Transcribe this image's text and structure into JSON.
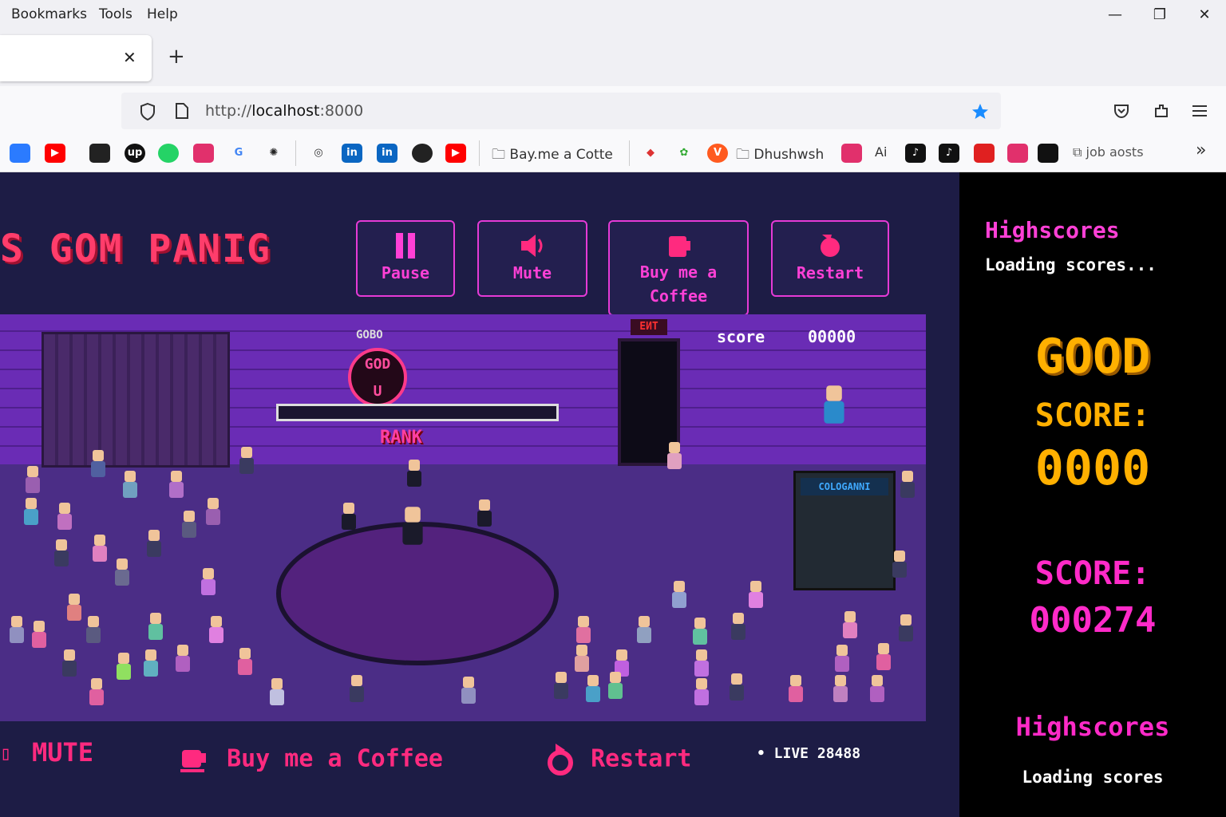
{
  "menu": {
    "bookmarks": "Bookmarks",
    "tools": "Tools",
    "help": "Help"
  },
  "window": {
    "minimize": "—",
    "maximize": "❐",
    "close": "✕"
  },
  "tab": {
    "close": "✕",
    "new": "+"
  },
  "address": {
    "scheme": "http://",
    "host": "localhost",
    "port": ":8000"
  },
  "bookmarks": {
    "folder1": "Bay.me a Cotte",
    "folder2": "Dhushwsh",
    "ai": "Ai",
    "folder3": "job aosts",
    "more": "»"
  },
  "game": {
    "title": "S GOM PANIG",
    "buttons": {
      "pause": "Pause",
      "mute": "Mute",
      "coffee_line1": "Buy me a",
      "coffee_line2": "Coffee",
      "restart": "Restart"
    },
    "scene": {
      "good_tag": "GOBO",
      "sign_top": "GOD",
      "sign_bottom": "U",
      "rank": "RANK",
      "exit": "EИT",
      "score_label": "score",
      "score_value": "00000",
      "bar_sign": "COLOGANNI"
    },
    "bottom": {
      "mute": "MUTE",
      "coffee": "Buy me a Coffee",
      "restart": "Restart",
      "live": "• LIVE 28488"
    }
  },
  "sidebar": {
    "title": "Highscores",
    "loading": "Loading scores...",
    "rating": "GOOD",
    "score_label": "SCORE:",
    "score_value": "0000",
    "score2_label": "SCORE:",
    "score2_value": "000274",
    "title2": "Highscores",
    "loading2": "Loading scores"
  },
  "colors": {
    "accent_pink": "#ff40d6",
    "score_gold": "#ffb000",
    "title_red": "#ff3d6b"
  }
}
